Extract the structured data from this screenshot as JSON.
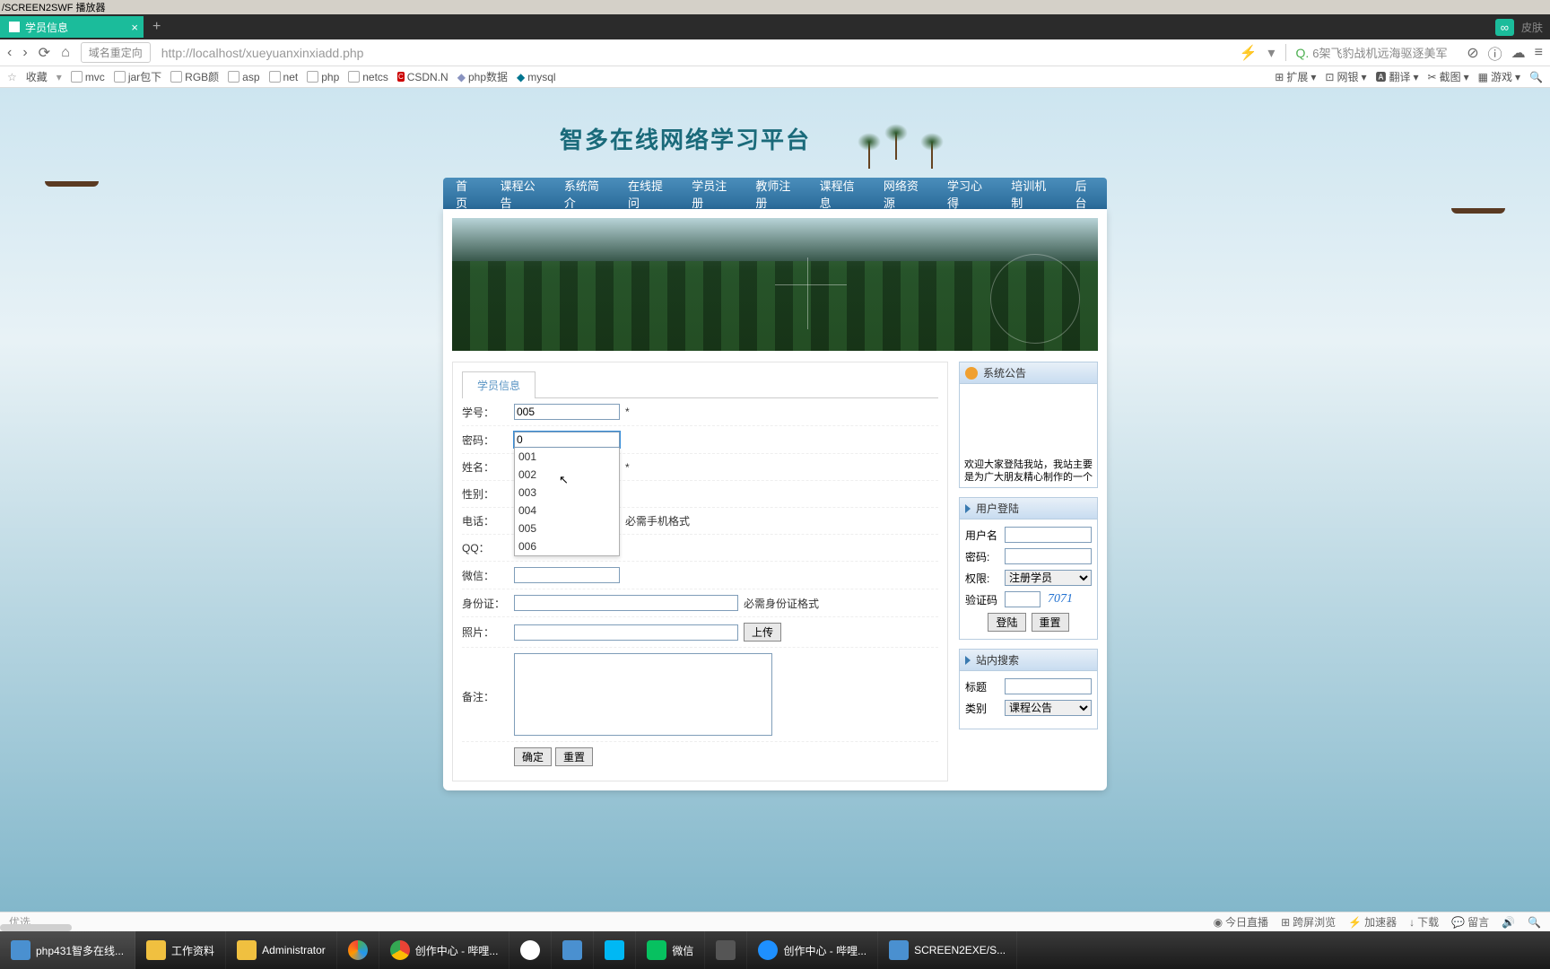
{
  "window": {
    "title": "/SCREEN2SWF 播放器"
  },
  "tab": {
    "title": "学员信息"
  },
  "addressbar": {
    "redirect_label": "域名重定向",
    "url": "http://localhost/xueyuanxinxiadd.php",
    "search_hint": "6架飞豹战机远海驱逐美军"
  },
  "bookmarks": {
    "fav": "收藏",
    "items": [
      "mvc",
      "jar包下",
      "RGB颜",
      "asp",
      "net",
      "php",
      "netcs",
      "CSDN.N",
      "php数据",
      "mysql"
    ],
    "right": [
      "扩展",
      "网银",
      "翻译",
      "截图",
      "游戏"
    ]
  },
  "site": {
    "title": "智多在线网络学习平台"
  },
  "nav": [
    "首页",
    "课程公告",
    "系统简介",
    "在线提问",
    "学员注册",
    "教师注册",
    "课程信息",
    "网络资源",
    "学习心得",
    "培训机制",
    "后台"
  ],
  "form": {
    "tab": "学员信息",
    "labels": {
      "xuehao": "学号：",
      "mima": "密码：",
      "xingming": "姓名：",
      "xingbie": "性别：",
      "dianhua": "电话：",
      "qq": "QQ：",
      "weixin": "微信：",
      "shenfenzheng": "身份证：",
      "zhaopian": "照片：",
      "beizhu": "备注："
    },
    "values": {
      "xuehao": "005",
      "mima": "0"
    },
    "hints": {
      "dianhua": "必需手机格式",
      "shenfenzheng": "必需身份证格式"
    },
    "req": "*",
    "autocomplete": [
      "001",
      "002",
      "003",
      "004",
      "005",
      "006"
    ],
    "upload": "上传",
    "submit": "确定",
    "reset": "重置"
  },
  "sidebar": {
    "announce": {
      "title": "系统公告",
      "text1": "欢迎大家登陆我站，我站主要",
      "text2": "是为广大朋友精心制作的一个"
    },
    "login": {
      "title": "用户登陆",
      "user": "用户名",
      "pwd": "密码:",
      "role": "权限:",
      "role_value": "注册学员",
      "captcha": "验证码",
      "captcha_value": "7071",
      "login_btn": "登陆",
      "reset_btn": "重置"
    },
    "search": {
      "title": "站内搜索",
      "biaoti": "标题",
      "leibie": "类别",
      "leibie_value": "课程公告"
    }
  },
  "statusbar": {
    "left": "优选",
    "items": [
      "今日直播",
      "跨屏浏览",
      "加速器",
      "下载",
      "留言"
    ]
  },
  "taskbar": {
    "items": [
      "php431智多在线...",
      "工作资料",
      "Administrator",
      "",
      "创作中心 - 哔哩...",
      "",
      "",
      "",
      "微信",
      "",
      "创作中心 - 哔哩...",
      "SCREEN2EXE/S..."
    ]
  }
}
